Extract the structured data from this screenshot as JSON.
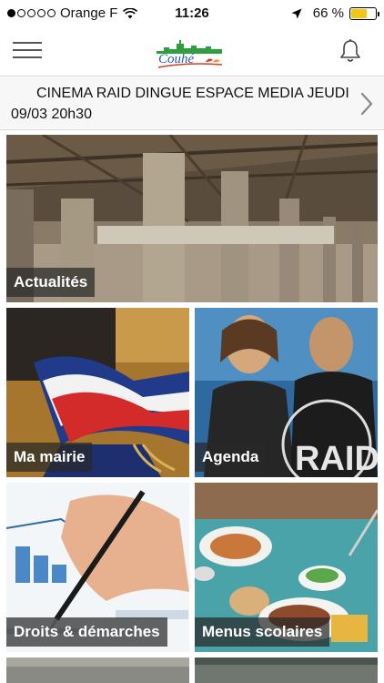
{
  "status_bar": {
    "carrier": "Orange F",
    "time": "11:26",
    "battery": "66 %",
    "battery_level": 0.66,
    "signal_bars_filled": 1,
    "signal_bars_total": 5
  },
  "nav": {
    "logo_text": "Couhé"
  },
  "ticker": {
    "line1": "CINEMA RAID DINGUE ESPACE MEDIA JEUDI",
    "line2": "09/03 20h30"
  },
  "tiles": [
    {
      "label": "Actualités"
    },
    {
      "label": "Ma mairie"
    },
    {
      "label": "Agenda"
    },
    {
      "label": "Droits & démarches"
    },
    {
      "label": "Menus scolaires"
    }
  ],
  "colors": {
    "battery_fill": "#f5c518",
    "label_bg": "#282828",
    "logo_green": "#2e9e3e",
    "logo_blue": "#2a5ba8",
    "logo_red": "#d63b2c"
  }
}
